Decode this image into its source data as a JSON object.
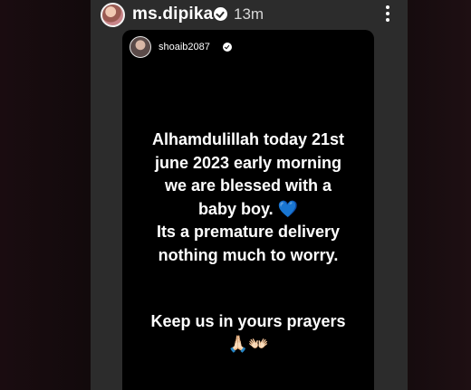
{
  "header": {
    "username": "ms.dipika",
    "time": "13m"
  },
  "story": {
    "username": "shoaib2087",
    "message_lines": [
      "Alhamdulillah today 21st",
      "june 2023 early morning",
      "we are blessed with a",
      "baby boy.",
      "Its a premature delivery",
      "nothing much to worry."
    ],
    "prayers_line": "Keep us in yours prayers",
    "heart_emoji": "💙",
    "pray_emoji": "🙏🏻",
    "hands_emoji": "👐🏻"
  },
  "icons": {
    "avatar": "profile-photo",
    "verified": "verified-badge-icon",
    "more": "more-vertical-icon"
  },
  "colors": {
    "panel": "#2c2c2c",
    "story_bg": "#000000",
    "heart": "#2d7ff0"
  }
}
